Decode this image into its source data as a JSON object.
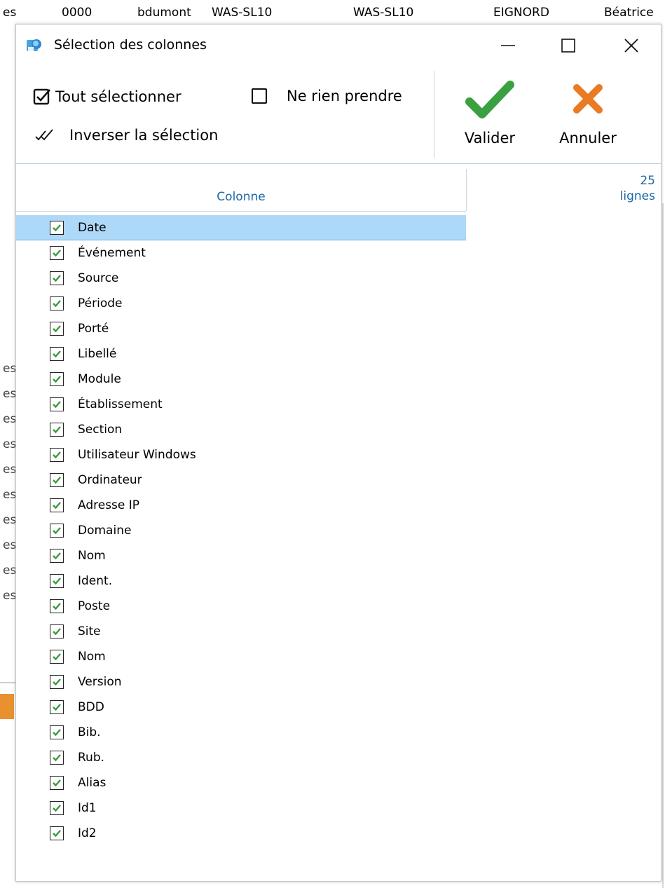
{
  "background": {
    "cells": [
      "0000",
      "bdumont",
      "WAS-SL10",
      "WAS-SL10",
      "EIGNORD",
      "Béatrice"
    ],
    "left_fragment": "es",
    "left_fragments": [
      "es",
      "es",
      "es",
      "es",
      "es",
      "es",
      "es",
      "es",
      "es",
      "es"
    ]
  },
  "dialog": {
    "title": "Sélection des colonnes",
    "minimize_glyph": "—",
    "close_glyph": "✕"
  },
  "ribbon": {
    "select_all": "Tout sélectionner",
    "select_none": "Ne rien prendre",
    "invert": "Inverser la sélection",
    "validate": "Valider",
    "cancel": "Annuler"
  },
  "grid": {
    "column_header": "Colonne",
    "count_value": "25",
    "count_unit": "lignes",
    "rows": [
      {
        "label": "Date",
        "checked": true
      },
      {
        "label": "Événement",
        "checked": true
      },
      {
        "label": "Source",
        "checked": true
      },
      {
        "label": "Période",
        "checked": true
      },
      {
        "label": "Porté",
        "checked": true
      },
      {
        "label": "Libellé",
        "checked": true
      },
      {
        "label": "Module",
        "checked": true
      },
      {
        "label": "Établissement",
        "checked": true
      },
      {
        "label": "Section",
        "checked": true
      },
      {
        "label": "Utilisateur Windows",
        "checked": true
      },
      {
        "label": "Ordinateur",
        "checked": true
      },
      {
        "label": "Adresse IP",
        "checked": true
      },
      {
        "label": "Domaine",
        "checked": true
      },
      {
        "label": "Nom",
        "checked": true
      },
      {
        "label": "Ident.",
        "checked": true
      },
      {
        "label": "Poste",
        "checked": true
      },
      {
        "label": "Site",
        "checked": true
      },
      {
        "label": "Nom",
        "checked": true
      },
      {
        "label": "Version",
        "checked": true
      },
      {
        "label": "BDD",
        "checked": true
      },
      {
        "label": "Bib.",
        "checked": true
      },
      {
        "label": "Rub.",
        "checked": true
      },
      {
        "label": "Alias",
        "checked": true
      },
      {
        "label": "Id1",
        "checked": true
      },
      {
        "label": "Id2",
        "checked": true
      }
    ],
    "selected_row": "Date"
  },
  "colors": {
    "check_green": "#3a9a3a",
    "selection_bg": "#add8f7",
    "header_blue": "#1b67a6",
    "cancel_orange": "#ea7b24"
  }
}
